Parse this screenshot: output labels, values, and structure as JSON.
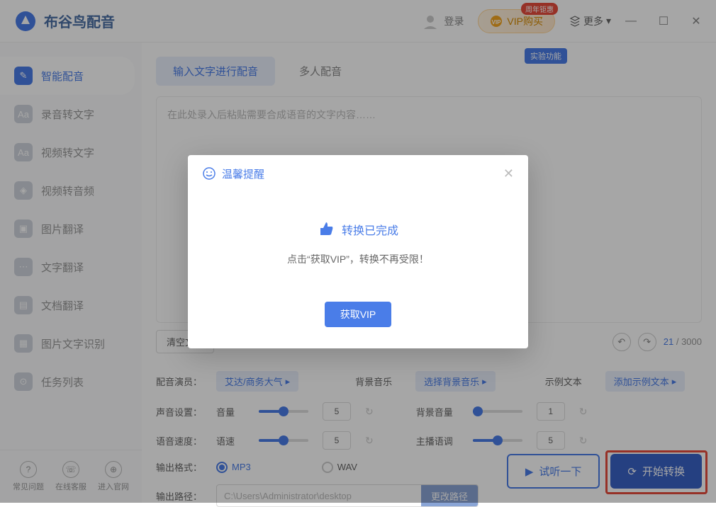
{
  "app": {
    "title": "布谷鸟配音"
  },
  "titlebar": {
    "login": "登录",
    "vip_button": "VIP购买",
    "vip_badge": "周年钜惠",
    "more": "更多"
  },
  "sidebar": {
    "items": [
      {
        "icon": "✎",
        "label": "智能配音",
        "active": true
      },
      {
        "icon": "Aa",
        "label": "录音转文字"
      },
      {
        "icon": "Aa",
        "label": "视频转文字"
      },
      {
        "icon": "◈",
        "label": "视频转音频"
      },
      {
        "icon": "▣",
        "label": "图片翻译"
      },
      {
        "icon": "⋯",
        "label": "文字翻译"
      },
      {
        "icon": "▤",
        "label": "文档翻译"
      },
      {
        "icon": "▦",
        "label": "图片文字识别"
      },
      {
        "icon": "⊙",
        "label": "任务列表"
      }
    ],
    "footer": [
      {
        "label": "常见问题"
      },
      {
        "label": "在线客服"
      },
      {
        "label": "进入官网"
      }
    ]
  },
  "tabs": {
    "text_input": "输入文字进行配音",
    "multi": "多人配音",
    "experiment_tag": "实验功能"
  },
  "editor": {
    "placeholder": "在此处录入后粘贴需要合成语音的文字内容……",
    "clear": "清空文本",
    "char_current": "21",
    "char_max": "3000"
  },
  "settings": {
    "actor_label": "配音演员：",
    "actor_value": "艾达/商务大气",
    "bg_label": "背景音乐",
    "bg_value": "选择背景音乐",
    "sample_label": "示例文本",
    "sample_value": "添加示例文本",
    "sound_label": "声音设置：",
    "volume_sub": "音量",
    "volume_value": "5",
    "bg_volume_sub": "背景音量",
    "bg_volume_value": "1",
    "speed_label": "语音速度：",
    "speed_sub": "语速",
    "speed_value": "5",
    "tone_sub": "主播语调",
    "tone_value": "5",
    "format_label": "输出格式：",
    "format_mp3": "MP3",
    "format_wav": "WAV",
    "path_label": "输出路径：",
    "path_value": "C:\\Users\\Administrator\\desktop",
    "path_change": "更改路径"
  },
  "actions": {
    "preview": "试听一下",
    "convert": "开始转换"
  },
  "modal": {
    "title": "温馨提醒",
    "status": "转换已完成",
    "desc": "点击“获取VIP”，转换不再受限！",
    "button": "获取VIP"
  }
}
